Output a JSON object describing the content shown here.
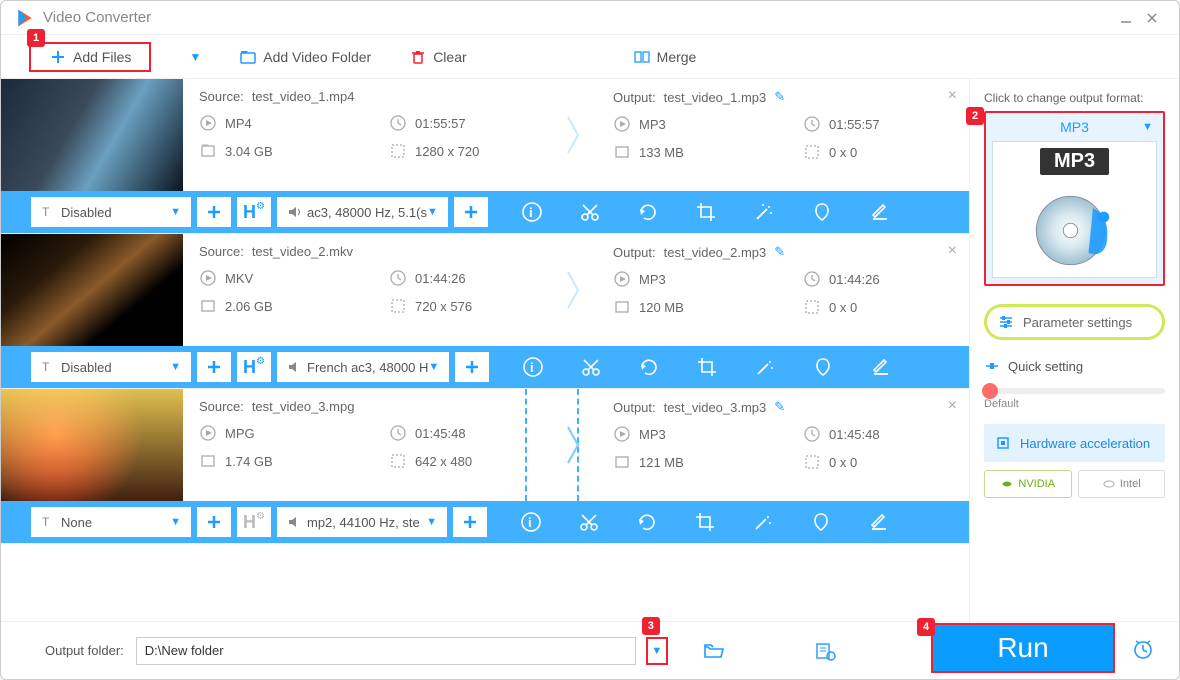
{
  "window": {
    "title": "Video Converter"
  },
  "toolbar": {
    "add_files": "Add Files",
    "add_folder": "Add Video Folder",
    "clear": "Clear",
    "merge": "Merge"
  },
  "callouts": {
    "c1": "1",
    "c2": "2",
    "c3": "3",
    "c4": "4"
  },
  "rows": [
    {
      "source_name": "test_video_1.mp4",
      "output_name": "test_video_1.mp3",
      "src_format": "MP4",
      "src_duration": "01:55:57",
      "src_size": "3.04 GB",
      "src_res": "1280 x 720",
      "out_format": "MP3",
      "out_duration": "01:55:57",
      "out_size": "133 MB",
      "out_res": "0 x 0",
      "subtitle": "Disabled",
      "audio": "ac3, 48000 Hz, 5.1(s"
    },
    {
      "source_name": "test_video_2.mkv",
      "output_name": "test_video_2.mp3",
      "src_format": "MKV",
      "src_duration": "01:44:26",
      "src_size": "2.06 GB",
      "src_res": "720 x 576",
      "out_format": "MP3",
      "out_duration": "01:44:26",
      "out_size": "120 MB",
      "out_res": "0 x 0",
      "subtitle": "Disabled",
      "audio": "French ac3, 48000 H"
    },
    {
      "source_name": "test_video_3.mpg",
      "output_name": "test_video_3.mp3",
      "src_format": "MPG",
      "src_duration": "01:45:48",
      "src_size": "1.74 GB",
      "src_res": "642 x 480",
      "out_format": "MP3",
      "out_duration": "01:45:48",
      "out_size": "121 MB",
      "out_res": "0 x 0",
      "subtitle": "None",
      "audio": "mp2, 44100 Hz, ste"
    }
  ],
  "labels": {
    "source_prefix": "Source: ",
    "output_prefix": "Output: "
  },
  "side": {
    "title": "Click to change output format:",
    "fmt_name": "MP3",
    "fmt_tag": "MP3",
    "param": "Parameter settings",
    "quick": "Quick setting",
    "slider": "Default",
    "hw": "Hardware acceleration",
    "nvidia": "NVIDIA",
    "intel": "Intel"
  },
  "bottom": {
    "label": "Output folder:",
    "path": "D:\\New folder",
    "run": "Run"
  }
}
